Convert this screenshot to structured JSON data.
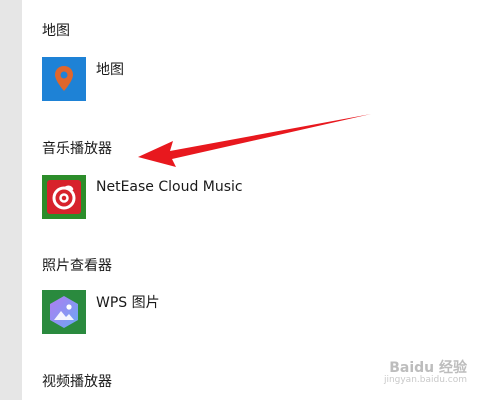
{
  "sections": [
    {
      "heading": "地图",
      "app_name": "地图",
      "icon": "map-pin-icon",
      "tile_color": "#1e82d6"
    },
    {
      "heading": "音乐播放器",
      "app_name": "NetEase Cloud Music",
      "icon": "netease-music-icon",
      "tile_color": "#2c8d2a"
    },
    {
      "heading": "照片查看器",
      "app_name": "WPS 图片",
      "icon": "wps-photo-icon",
      "tile_color": "#2a8a3e"
    },
    {
      "heading": "视频播放器"
    }
  ],
  "watermark": {
    "brand": "Baidu 经验",
    "url": "jingyan.baidu.com"
  },
  "colors": {
    "arrow": "#e8181e",
    "sidebar": "#e6e6e6"
  }
}
